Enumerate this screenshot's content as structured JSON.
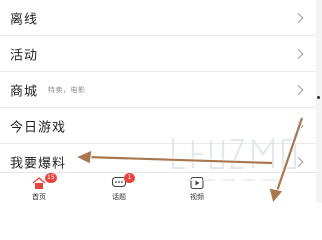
{
  "menu": {
    "items": [
      {
        "label": "离线",
        "sub": ""
      },
      {
        "label": "活动",
        "sub": ""
      },
      {
        "label": "商城",
        "sub": "特卖，电影"
      },
      {
        "label": "今日游戏",
        "sub": ""
      },
      {
        "label": "我要爆料",
        "sub": ""
      }
    ]
  },
  "tabbar": {
    "tabs": [
      {
        "label": "首页",
        "badge": "15",
        "icon": "home-icon"
      },
      {
        "label": "话题",
        "badge": "1",
        "icon": "chat-bubble-icon"
      },
      {
        "label": "视频",
        "badge": "",
        "icon": "video-play-icon"
      }
    ]
  },
  "annotation": {
    "arrow_color": "#a8774e",
    "arrow_outline": "#ffffff"
  },
  "watermark": {
    "logo": "watermark-logo"
  },
  "colors": {
    "badge": "#e8453c",
    "text": "#222222",
    "divider": "#e9e9e9"
  }
}
